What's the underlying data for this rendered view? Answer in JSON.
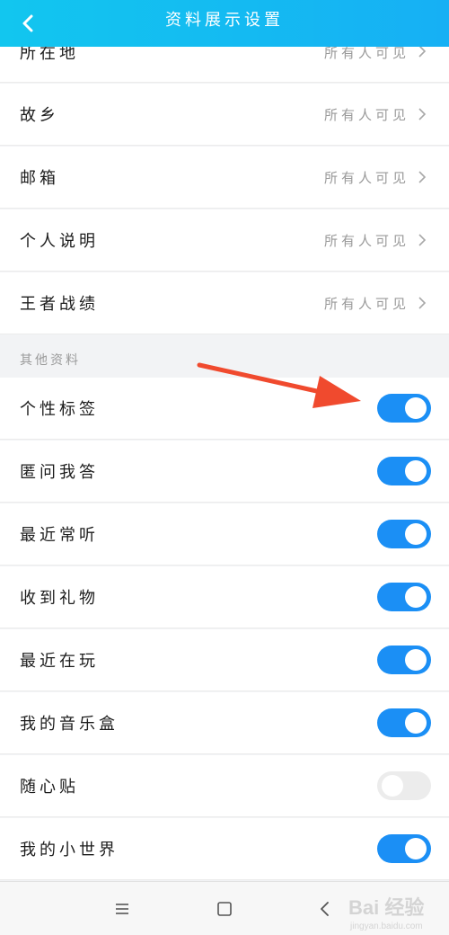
{
  "header": {
    "title": "资料展示设置"
  },
  "visibility_rows": [
    {
      "label": "所在地",
      "value": "所有人可见"
    },
    {
      "label": "故乡",
      "value": "所有人可见"
    },
    {
      "label": "邮箱",
      "value": "所有人可见"
    },
    {
      "label": "个人说明",
      "value": "所有人可见"
    },
    {
      "label": "王者战绩",
      "value": "所有人可见"
    }
  ],
  "other_section": {
    "title": "其他资料"
  },
  "toggle_rows": [
    {
      "label": "个性标签",
      "on": true
    },
    {
      "label": "匿问我答",
      "on": true
    },
    {
      "label": "最近常听",
      "on": true
    },
    {
      "label": "收到礼物",
      "on": true
    },
    {
      "label": "最近在玩",
      "on": true
    },
    {
      "label": "我的音乐盒",
      "on": true
    },
    {
      "label": "随心贴",
      "on": false
    },
    {
      "label": "我的小世界",
      "on": true
    }
  ],
  "watermark": {
    "main": "Bai 经验",
    "sub": "jingyan.baidu.com"
  },
  "colors": {
    "header_start": "#12c6ef",
    "header_end": "#16b0f4",
    "toggle_on": "#1b8ff5",
    "toggle_off": "#ececec",
    "annotation_arrow": "#f04a2e"
  }
}
